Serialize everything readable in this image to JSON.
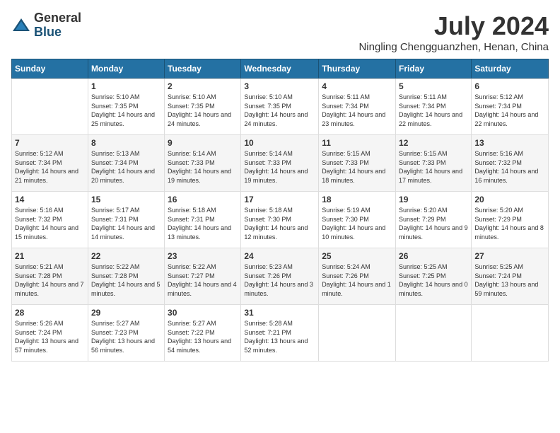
{
  "logo": {
    "general": "General",
    "blue": "Blue"
  },
  "title": "July 2024",
  "location": "Ningling Chengguanzhen, Henan, China",
  "days_of_week": [
    "Sunday",
    "Monday",
    "Tuesday",
    "Wednesday",
    "Thursday",
    "Friday",
    "Saturday"
  ],
  "weeks": [
    [
      {
        "day": "",
        "sunrise": "",
        "sunset": "",
        "daylight": ""
      },
      {
        "day": "1",
        "sunrise": "Sunrise: 5:10 AM",
        "sunset": "Sunset: 7:35 PM",
        "daylight": "Daylight: 14 hours and 25 minutes."
      },
      {
        "day": "2",
        "sunrise": "Sunrise: 5:10 AM",
        "sunset": "Sunset: 7:35 PM",
        "daylight": "Daylight: 14 hours and 24 minutes."
      },
      {
        "day": "3",
        "sunrise": "Sunrise: 5:10 AM",
        "sunset": "Sunset: 7:35 PM",
        "daylight": "Daylight: 14 hours and 24 minutes."
      },
      {
        "day": "4",
        "sunrise": "Sunrise: 5:11 AM",
        "sunset": "Sunset: 7:34 PM",
        "daylight": "Daylight: 14 hours and 23 minutes."
      },
      {
        "day": "5",
        "sunrise": "Sunrise: 5:11 AM",
        "sunset": "Sunset: 7:34 PM",
        "daylight": "Daylight: 14 hours and 22 minutes."
      },
      {
        "day": "6",
        "sunrise": "Sunrise: 5:12 AM",
        "sunset": "Sunset: 7:34 PM",
        "daylight": "Daylight: 14 hours and 22 minutes."
      }
    ],
    [
      {
        "day": "7",
        "sunrise": "Sunrise: 5:12 AM",
        "sunset": "Sunset: 7:34 PM",
        "daylight": "Daylight: 14 hours and 21 minutes."
      },
      {
        "day": "8",
        "sunrise": "Sunrise: 5:13 AM",
        "sunset": "Sunset: 7:34 PM",
        "daylight": "Daylight: 14 hours and 20 minutes."
      },
      {
        "day": "9",
        "sunrise": "Sunrise: 5:14 AM",
        "sunset": "Sunset: 7:33 PM",
        "daylight": "Daylight: 14 hours and 19 minutes."
      },
      {
        "day": "10",
        "sunrise": "Sunrise: 5:14 AM",
        "sunset": "Sunset: 7:33 PM",
        "daylight": "Daylight: 14 hours and 19 minutes."
      },
      {
        "day": "11",
        "sunrise": "Sunrise: 5:15 AM",
        "sunset": "Sunset: 7:33 PM",
        "daylight": "Daylight: 14 hours and 18 minutes."
      },
      {
        "day": "12",
        "sunrise": "Sunrise: 5:15 AM",
        "sunset": "Sunset: 7:33 PM",
        "daylight": "Daylight: 14 hours and 17 minutes."
      },
      {
        "day": "13",
        "sunrise": "Sunrise: 5:16 AM",
        "sunset": "Sunset: 7:32 PM",
        "daylight": "Daylight: 14 hours and 16 minutes."
      }
    ],
    [
      {
        "day": "14",
        "sunrise": "Sunrise: 5:16 AM",
        "sunset": "Sunset: 7:32 PM",
        "daylight": "Daylight: 14 hours and 15 minutes."
      },
      {
        "day": "15",
        "sunrise": "Sunrise: 5:17 AM",
        "sunset": "Sunset: 7:31 PM",
        "daylight": "Daylight: 14 hours and 14 minutes."
      },
      {
        "day": "16",
        "sunrise": "Sunrise: 5:18 AM",
        "sunset": "Sunset: 7:31 PM",
        "daylight": "Daylight: 14 hours and 13 minutes."
      },
      {
        "day": "17",
        "sunrise": "Sunrise: 5:18 AM",
        "sunset": "Sunset: 7:30 PM",
        "daylight": "Daylight: 14 hours and 12 minutes."
      },
      {
        "day": "18",
        "sunrise": "Sunrise: 5:19 AM",
        "sunset": "Sunset: 7:30 PM",
        "daylight": "Daylight: 14 hours and 10 minutes."
      },
      {
        "day": "19",
        "sunrise": "Sunrise: 5:20 AM",
        "sunset": "Sunset: 7:29 PM",
        "daylight": "Daylight: 14 hours and 9 minutes."
      },
      {
        "day": "20",
        "sunrise": "Sunrise: 5:20 AM",
        "sunset": "Sunset: 7:29 PM",
        "daylight": "Daylight: 14 hours and 8 minutes."
      }
    ],
    [
      {
        "day": "21",
        "sunrise": "Sunrise: 5:21 AM",
        "sunset": "Sunset: 7:28 PM",
        "daylight": "Daylight: 14 hours and 7 minutes."
      },
      {
        "day": "22",
        "sunrise": "Sunrise: 5:22 AM",
        "sunset": "Sunset: 7:28 PM",
        "daylight": "Daylight: 14 hours and 5 minutes."
      },
      {
        "day": "23",
        "sunrise": "Sunrise: 5:22 AM",
        "sunset": "Sunset: 7:27 PM",
        "daylight": "Daylight: 14 hours and 4 minutes."
      },
      {
        "day": "24",
        "sunrise": "Sunrise: 5:23 AM",
        "sunset": "Sunset: 7:26 PM",
        "daylight": "Daylight: 14 hours and 3 minutes."
      },
      {
        "day": "25",
        "sunrise": "Sunrise: 5:24 AM",
        "sunset": "Sunset: 7:26 PM",
        "daylight": "Daylight: 14 hours and 1 minute."
      },
      {
        "day": "26",
        "sunrise": "Sunrise: 5:25 AM",
        "sunset": "Sunset: 7:25 PM",
        "daylight": "Daylight: 14 hours and 0 minutes."
      },
      {
        "day": "27",
        "sunrise": "Sunrise: 5:25 AM",
        "sunset": "Sunset: 7:24 PM",
        "daylight": "Daylight: 13 hours and 59 minutes."
      }
    ],
    [
      {
        "day": "28",
        "sunrise": "Sunrise: 5:26 AM",
        "sunset": "Sunset: 7:24 PM",
        "daylight": "Daylight: 13 hours and 57 minutes."
      },
      {
        "day": "29",
        "sunrise": "Sunrise: 5:27 AM",
        "sunset": "Sunset: 7:23 PM",
        "daylight": "Daylight: 13 hours and 56 minutes."
      },
      {
        "day": "30",
        "sunrise": "Sunrise: 5:27 AM",
        "sunset": "Sunset: 7:22 PM",
        "daylight": "Daylight: 13 hours and 54 minutes."
      },
      {
        "day": "31",
        "sunrise": "Sunrise: 5:28 AM",
        "sunset": "Sunset: 7:21 PM",
        "daylight": "Daylight: 13 hours and 52 minutes."
      },
      {
        "day": "",
        "sunrise": "",
        "sunset": "",
        "daylight": ""
      },
      {
        "day": "",
        "sunrise": "",
        "sunset": "",
        "daylight": ""
      },
      {
        "day": "",
        "sunrise": "",
        "sunset": "",
        "daylight": ""
      }
    ]
  ]
}
